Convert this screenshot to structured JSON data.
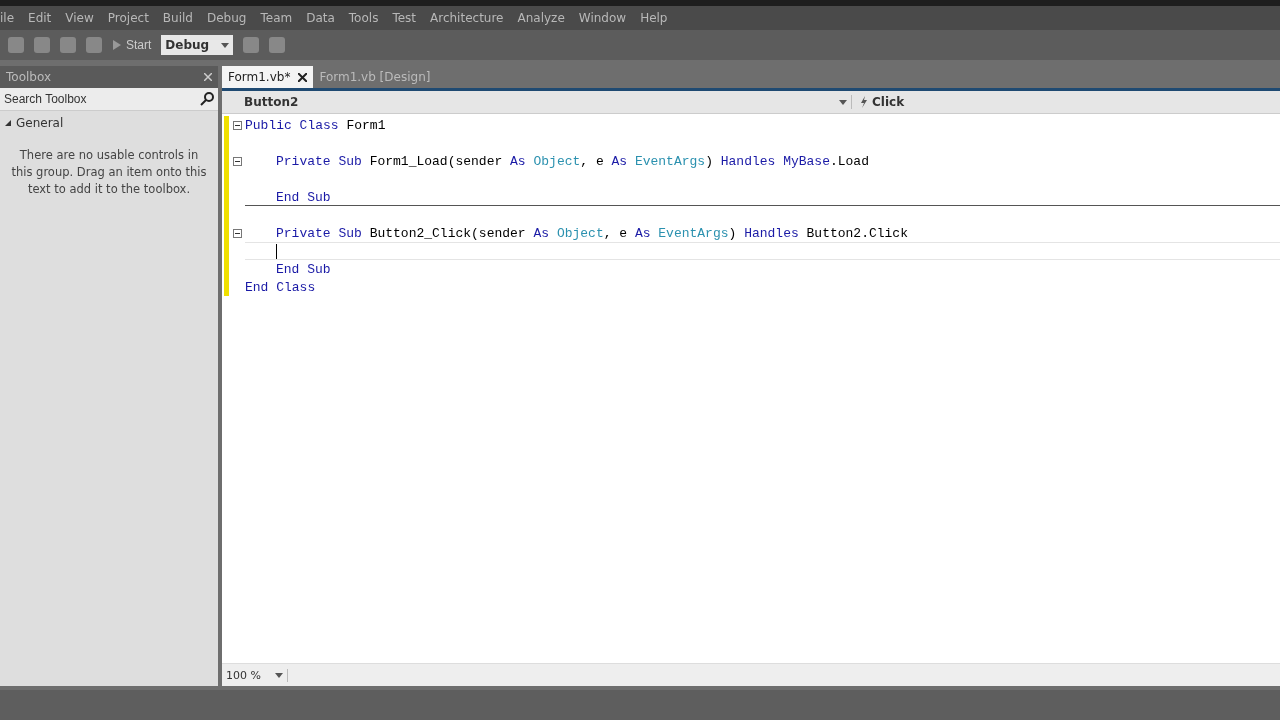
{
  "menu_bar": [
    "ile",
    "Edit",
    "View",
    "Project",
    "Build",
    "Debug",
    "Team",
    "Data",
    "Tools",
    "Test",
    "Architecture",
    "Analyze",
    "Window",
    "Help"
  ],
  "toolbar": {
    "start_label": "Start",
    "configuration": "Debug"
  },
  "toolbox": {
    "title": "Toolbox",
    "search": {
      "placeholder": "Search Toolbox"
    },
    "group": {
      "label": "General",
      "expanded": true
    },
    "message": "There are no usable controls in this group. Drag an item onto this text to add it to the toolbox."
  },
  "tabs": [
    {
      "label": "Form1.vb*",
      "selected": true
    },
    {
      "label": "Form1.vb [Design]",
      "selected": false
    }
  ],
  "nav_bar": {
    "object": "Button2",
    "event": "Click"
  },
  "code": [
    {
      "collapsible": true,
      "tokens": [
        {
          "text": "Public Class",
          "kind": "keyword"
        },
        {
          "text": " Form1",
          "kind": "plain"
        }
      ]
    },
    {
      "collapsible": false
    },
    {
      "collapsible": true,
      "indented": true,
      "tokens": [
        {
          "text": "Private Sub",
          "kind": "keyword"
        },
        {
          "text": " Form1_Load(sender ",
          "kind": "plain"
        },
        {
          "text": "As",
          "kind": "keyword"
        },
        {
          "text": " Object",
          "kind": "type"
        },
        {
          "text": ", e ",
          "kind": "plain"
        },
        {
          "text": "As",
          "kind": "keyword"
        },
        {
          "text": " EventArgs",
          "kind": "type"
        },
        {
          "text": ") ",
          "kind": "plain"
        },
        {
          "text": "Handles MyBase",
          "kind": "keyword"
        },
        {
          "text": ".Load",
          "kind": "plain"
        }
      ]
    },
    {
      "collapsible": false
    },
    {
      "collapsible": false,
      "indented": true,
      "separator": true,
      "tokens": [
        {
          "text": "End Sub",
          "kind": "keyword"
        }
      ]
    },
    {
      "collapsible": false
    },
    {
      "collapsible": true,
      "indented": true,
      "tokens": [
        {
          "text": "Private Sub",
          "kind": "keyword"
        },
        {
          "text": " Button2_Click(sender ",
          "kind": "plain"
        },
        {
          "text": "As",
          "kind": "keyword"
        },
        {
          "text": " Object",
          "kind": "type"
        },
        {
          "text": ", e ",
          "kind": "plain"
        },
        {
          "text": "As",
          "kind": "keyword"
        },
        {
          "text": " EventArgs",
          "kind": "type"
        },
        {
          "text": ") ",
          "kind": "plain"
        },
        {
          "text": "Handles",
          "kind": "keyword"
        },
        {
          "text": " Button2.Click",
          "kind": "plain"
        }
      ]
    },
    {
      "collapsible": false,
      "current": true
    },
    {
      "collapsible": false,
      "indented": true,
      "tokens": [
        {
          "text": "End Sub",
          "kind": "keyword"
        }
      ]
    },
    {
      "collapsible": false,
      "tokens": [
        {
          "text": "End Class",
          "kind": "keyword"
        }
      ]
    }
  ],
  "zoom": "100 %"
}
